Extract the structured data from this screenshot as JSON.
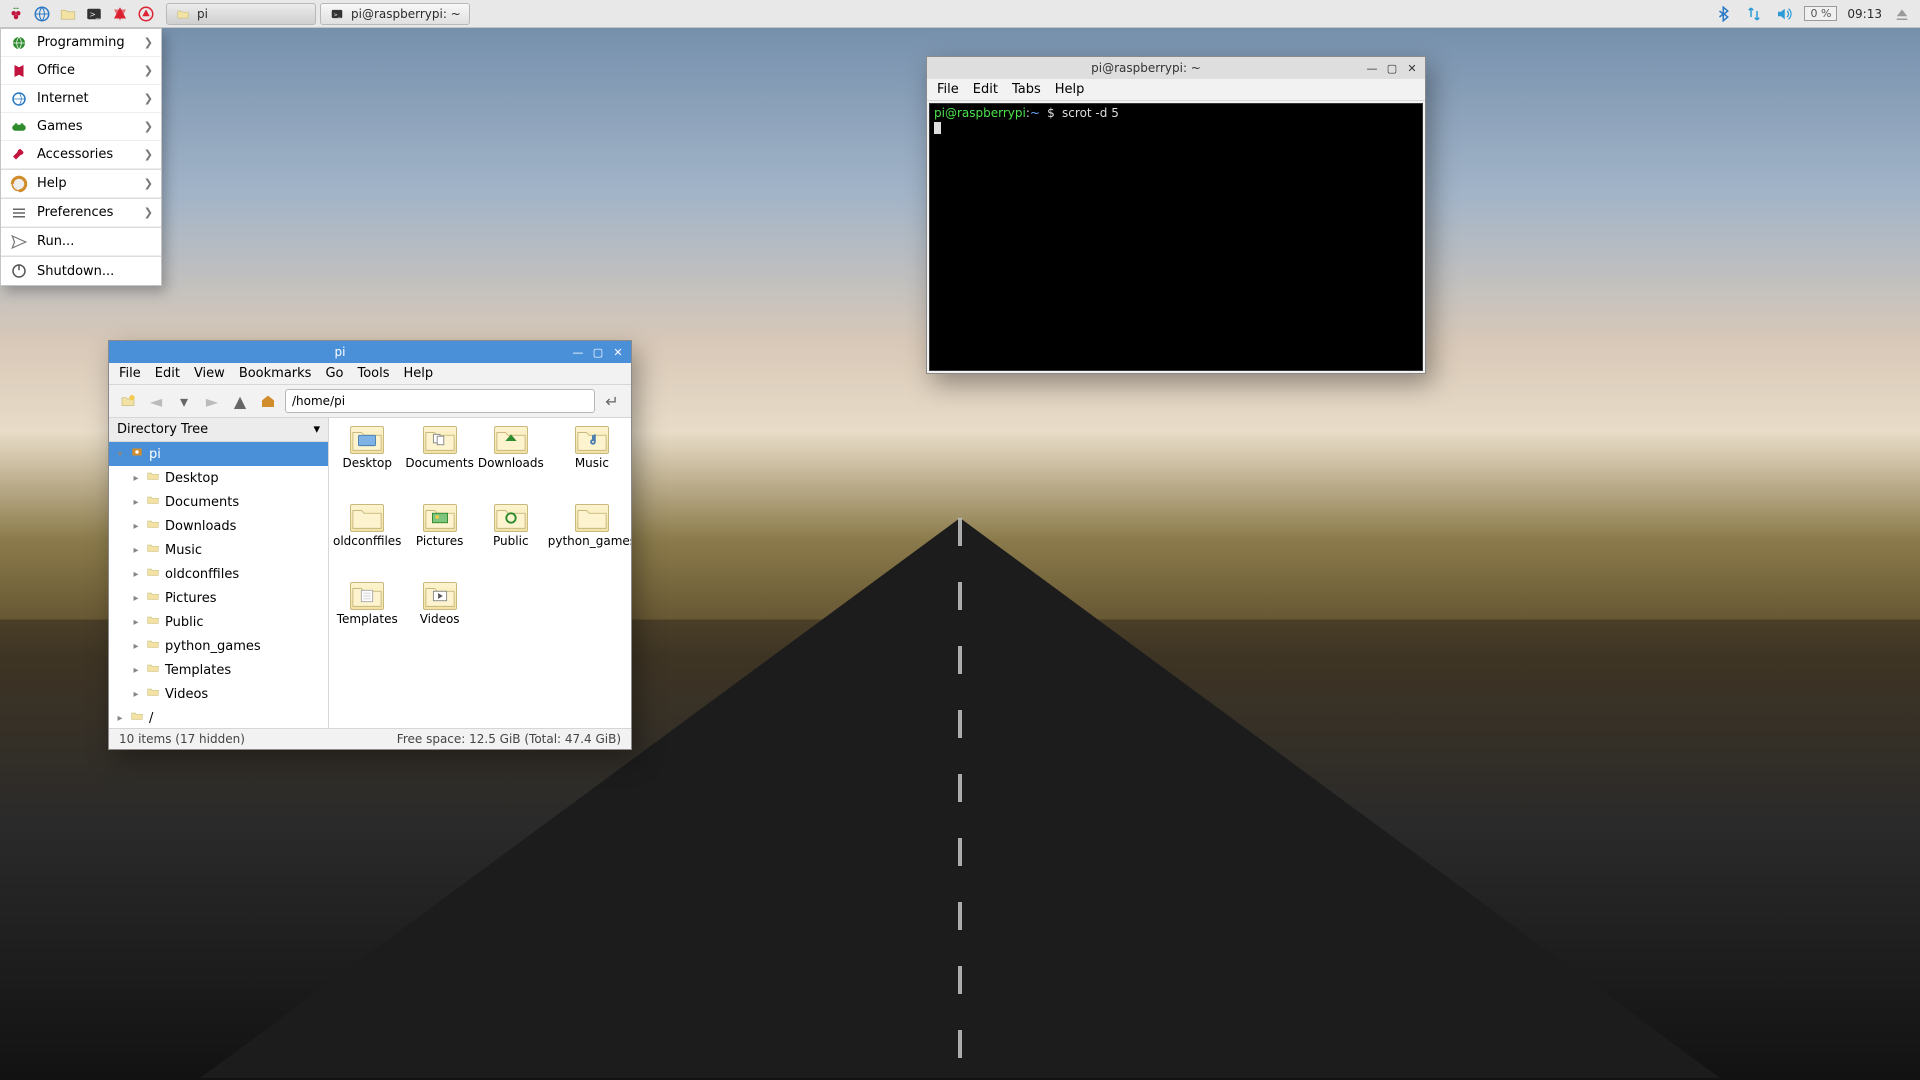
{
  "panel": {
    "tasks": [
      {
        "label": "pi",
        "icon": "folder"
      },
      {
        "label": "pi@raspberrypi: ~",
        "icon": "terminal"
      }
    ],
    "tray": {
      "cpu": "0 %",
      "clock": "09:13"
    }
  },
  "start_menu": {
    "groups": [
      [
        {
          "label": "Programming",
          "sub": true,
          "icon": "globe"
        },
        {
          "label": "Office",
          "sub": true,
          "icon": "office"
        },
        {
          "label": "Internet",
          "sub": true,
          "icon": "globe-blue"
        },
        {
          "label": "Games",
          "sub": true,
          "icon": "gamepad"
        },
        {
          "label": "Accessories",
          "sub": true,
          "icon": "tool"
        }
      ],
      [
        {
          "label": "Help",
          "sub": true,
          "icon": "help"
        }
      ],
      [
        {
          "label": "Preferences",
          "sub": true,
          "icon": "prefs"
        }
      ],
      [
        {
          "label": "Run...",
          "sub": false,
          "icon": "run"
        }
      ],
      [
        {
          "label": "Shutdown...",
          "sub": false,
          "icon": "power"
        }
      ]
    ]
  },
  "file_manager": {
    "title": "pi",
    "menubar": [
      "File",
      "Edit",
      "View",
      "Bookmarks",
      "Go",
      "Tools",
      "Help"
    ],
    "path": "/home/pi",
    "side_header": "Directory Tree",
    "tree_root": "pi",
    "tree": [
      "Desktop",
      "Documents",
      "Downloads",
      "Music",
      "oldconffiles",
      "Pictures",
      "Public",
      "python_games",
      "Templates",
      "Videos"
    ],
    "tree_tail": "/",
    "folders": [
      {
        "name": "Desktop",
        "glyph": "desktop"
      },
      {
        "name": "Documents",
        "glyph": "docs"
      },
      {
        "name": "Downloads",
        "glyph": "down"
      },
      {
        "name": "Music",
        "glyph": "music"
      },
      {
        "name": "oldconffiles",
        "glyph": ""
      },
      {
        "name": "Pictures",
        "glyph": "pic"
      },
      {
        "name": "Public",
        "glyph": "public"
      },
      {
        "name": "python_games",
        "glyph": ""
      },
      {
        "name": "Templates",
        "glyph": "tmpl"
      },
      {
        "name": "Videos",
        "glyph": "vid"
      }
    ],
    "status_left": "10 items (17 hidden)",
    "status_right": "Free space: 12.5 GiB (Total: 47.4 GiB)"
  },
  "terminal": {
    "title": "pi@raspberrypi: ~",
    "menubar": [
      "File",
      "Edit",
      "Tabs",
      "Help"
    ],
    "prompt_user": "pi@raspberrypi",
    "prompt_path": "~",
    "prompt_sep": "$",
    "command": "scrot -d 5"
  }
}
